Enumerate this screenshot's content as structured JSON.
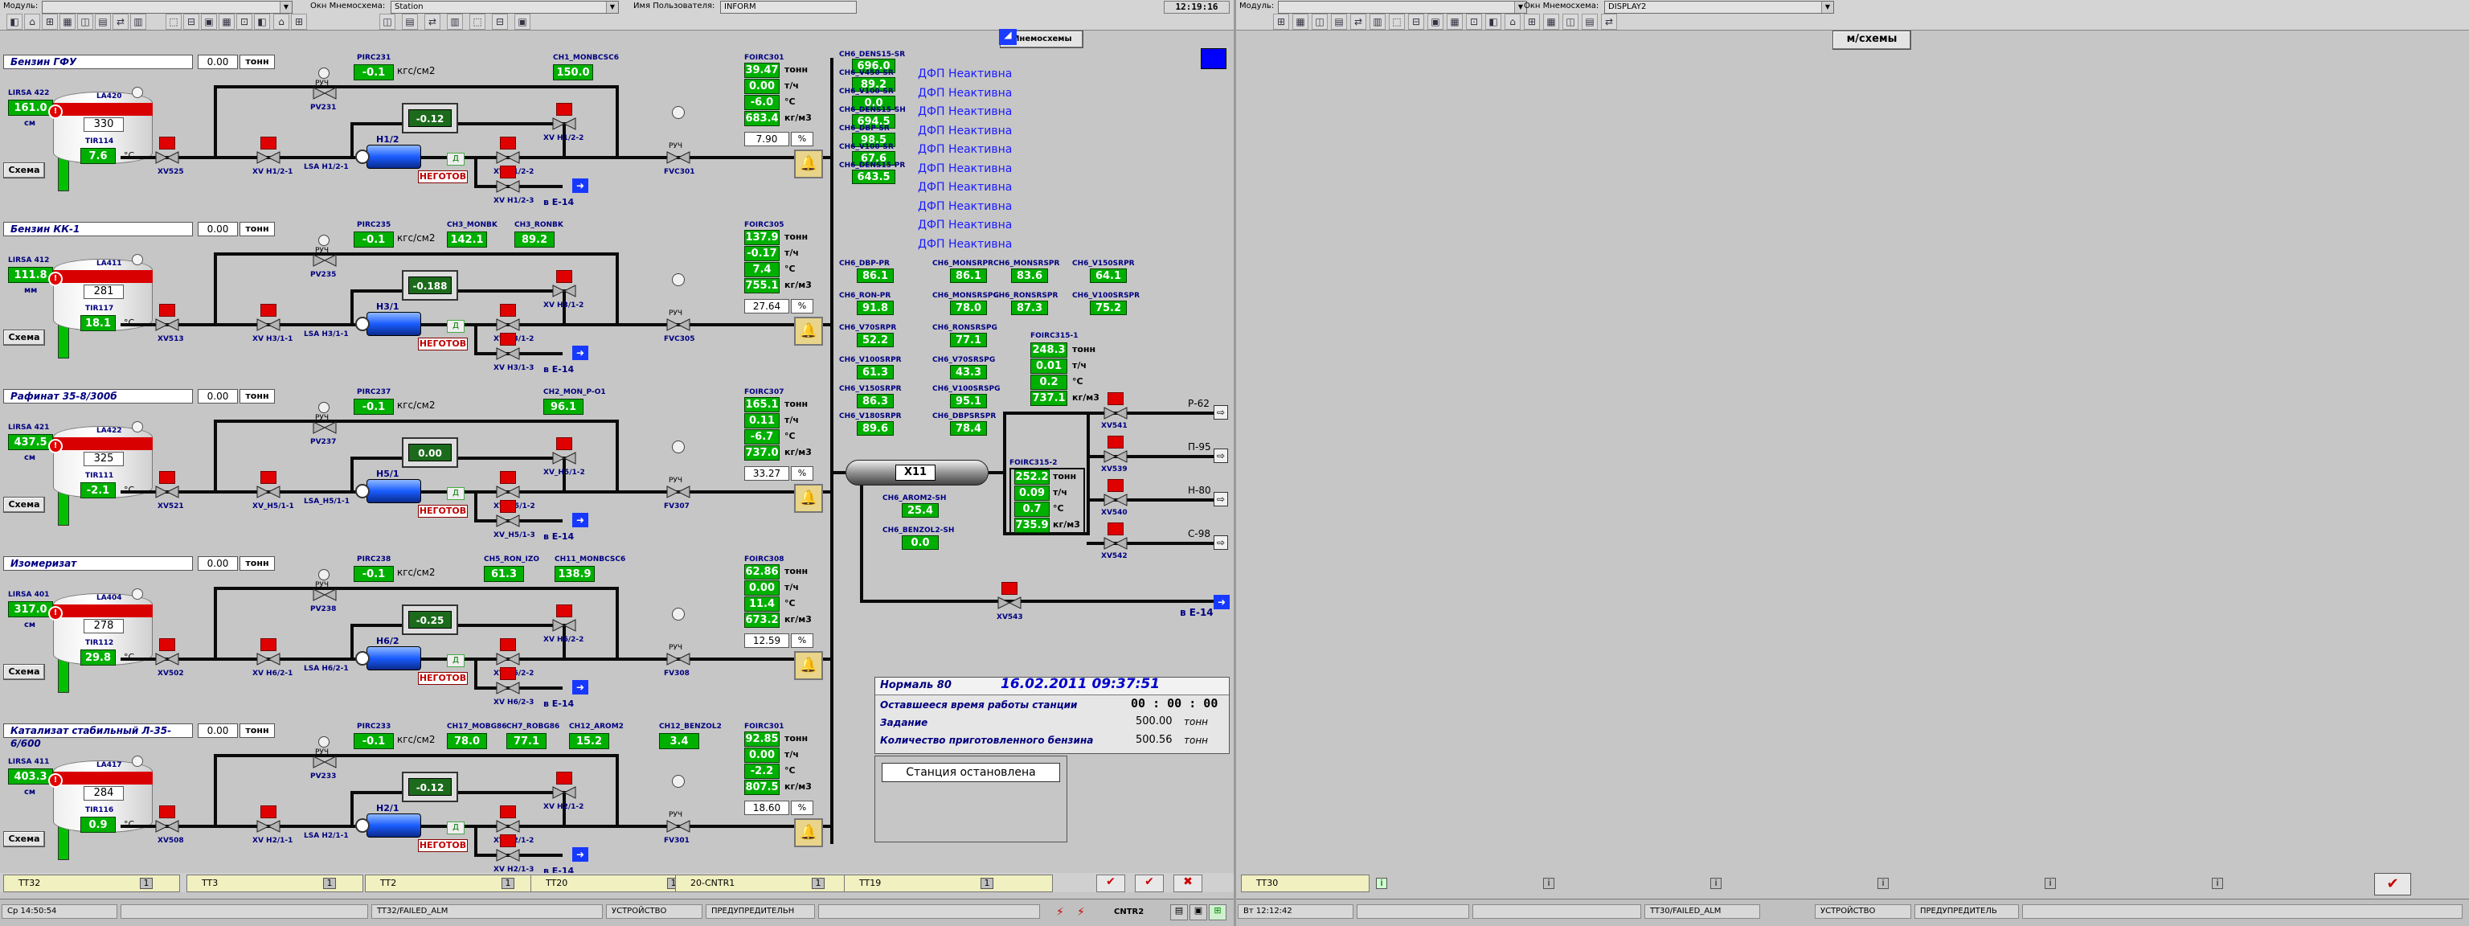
{
  "left_top": {
    "module_label": "Модуль:",
    "module_value": "",
    "mnemo_label": "Окн Мнемосхема:",
    "mnemo_value": "Station",
    "user_label": "Имя Пользователя:",
    "user_value": "INFORM",
    "time": "12:19:16",
    "mnemo_button": "Мнемосхемы"
  },
  "right_top": {
    "module_label": "Модуль:",
    "module_value": "",
    "mnemo_label": "Окн Мнемосхема:",
    "mnemo_value": "DISPLAY2",
    "scheme_button": "м/схемы"
  },
  "common": {
    "schema_btn": "Схема",
    "ton": "тонн",
    "tph": "т/ч",
    "degc": "°C",
    "kgm3": "кг/м3",
    "kgs": "кгс/см2",
    "pct": "%",
    "not_ready": "НЕГОТОВ",
    "d": "Д",
    "cm": "см",
    "mm": "мм",
    "ruch": "РУЧ",
    "to_e14": "в Е-14"
  },
  "lines": [
    {
      "title": "Бензин ГФУ",
      "title_val": "0.00",
      "lirsa": "LIRSA 422",
      "lirsa_val": "161.0",
      "lirsa_unit": "см",
      "level_pct": 0.7,
      "la": "LA420",
      "tank_val": "330",
      "tir": "TIR114",
      "tir_val": "7.6",
      "pirc": "PIRC231",
      "pirc_val": "-0.1",
      "pv": "PV231",
      "motor_val": "-0.12",
      "xv_left": "XV525",
      "xv_mid": "XV Н1/2-1",
      "lsa": "LSA Н1/2-1",
      "pump": "Н1/2",
      "xv_r1": "XV Н1/2-2",
      "xv_r2": "XV Н1/2-3",
      "fv": "FVC301",
      "tags": [
        {
          "label": "CH1_MONBCSC6",
          "val": "150.0"
        }
      ],
      "foirc": "FOIRC301",
      "f_ton": "39.47",
      "f_tph": "0.00",
      "f_t": "-6.0",
      "f_kg": "683.4",
      "pct_val": "7.90"
    },
    {
      "title": "Бензин КК-1",
      "title_val": "0.00",
      "lirsa": "LIRSA 412",
      "lirsa_val": "111.8",
      "lirsa_unit": "мм",
      "level_pct": 0.55,
      "la": "LA411",
      "tank_val": "281",
      "tir": "TIR117",
      "tir_val": "18.1",
      "pirc": "PIRC235",
      "pirc_val": "-0.1",
      "pv": "PV235",
      "motor_val": "-0.188",
      "xv_left": "XV513",
      "xv_mid": "XV Н3/1-1",
      "lsa": "LSA Н3/1-1",
      "pump": "Н3/1",
      "xv_r1": "XV Н3/1-2",
      "xv_r2": "XV Н3/1-3",
      "fv": "FVC305",
      "tags": [
        {
          "label": "CH3_MONBK",
          "val": "142.1"
        },
        {
          "label": "CH3_RONBK",
          "val": "89.2"
        }
      ],
      "foirc": "FOIRC305",
      "f_ton": "137.9",
      "f_tph": "-0.17",
      "f_t": "7.4",
      "f_kg": "755.1",
      "pct_val": "27.64"
    },
    {
      "title": "Рафинат 35-8/300б",
      "title_val": "0.00",
      "lirsa": "LIRSA 421",
      "lirsa_val": "437.5",
      "lirsa_unit": "см",
      "level_pct": 0.85,
      "la": "LA422",
      "tank_val": "325",
      "tir": "TIR111",
      "tir_val": "-2.1",
      "pirc": "PIRC237",
      "pirc_val": "-0.1",
      "pv": "PV237",
      "motor_val": "0.00",
      "xv_left": "XV521",
      "xv_mid": "XV_Н5/1-1",
      "lsa": "LSA_Н5/1-1",
      "pump": "Н5/1",
      "xv_r1": "XV_Н5/1-2",
      "xv_r2": "XV_Н5/1-3",
      "fv": "FV307",
      "tags": [
        {
          "label": "CH2_MON_P-O1",
          "val": "96.1"
        }
      ],
      "foirc": "FOIRC307",
      "f_ton": "165.1",
      "f_tph": "0.11",
      "f_t": "-6.7",
      "f_kg": "737.0",
      "pct_val": "33.27"
    },
    {
      "title": "Изомеризат",
      "title_val": "0.00",
      "lirsa": "LIRSA 401",
      "lirsa_val": "317.0",
      "lirsa_unit": "см",
      "level_pct": 0.75,
      "la": "LA404",
      "tank_val": "278",
      "tir": "TIR112",
      "tir_val": "29.8",
      "pirc": "PIRC238",
      "pirc_val": "-0.1",
      "pv": "PV238",
      "motor_val": "-0.25",
      "xv_left": "XV502",
      "xv_mid": "XV Н6/2-1",
      "lsa": "LSA Н6/2-1",
      "pump": "Н6/2",
      "xv_r1": "XV Н6/2-2",
      "xv_r2": "XV Н6/2-3",
      "fv": "FV308",
      "tags": [
        {
          "label": "CH5_RON_IZO",
          "val": "61.3"
        },
        {
          "label": "CH11_MONBCSC6",
          "val": "138.9"
        }
      ],
      "foirc": "FOIRC308",
      "f_ton": "62.86",
      "f_tph": "0.00",
      "f_t": "11.4",
      "f_kg": "673.2",
      "pct_val": "12.59"
    },
    {
      "title": "Катализат стабильный Л-35-6/600",
      "title_val": "0.00",
      "lirsa": "LIRSA 411",
      "lirsa_val": "403.3",
      "lirsa_unit": "см",
      "level_pct": 0.8,
      "la": "LA417",
      "tank_val": "284",
      "tir": "TIR116",
      "tir_val": "0.9",
      "pirc": "PIRC233",
      "pirc_val": "-0.1",
      "pv": "PV233",
      "motor_val": "-0.12",
      "xv_left": "XV508",
      "xv_mid": "XV Н2/1-1",
      "lsa": "LSA Н2/1-1",
      "pump": "Н2/1",
      "xv_r1": "XV Н2/1-2",
      "xv_r2": "XV Н2/1-3",
      "fv": "FV301",
      "tags": [
        {
          "label": "CH17_MOBG86",
          "val": "78.0"
        },
        {
          "label": "CH7_ROBG86",
          "val": "77.1"
        },
        {
          "label": "CH12_AROM2",
          "val": "15.2"
        },
        {
          "label": "CH12_BENZOL2",
          "val": "3.4"
        }
      ],
      "foirc": "FOIRC301",
      "f_ton": "92.85",
      "f_tph": "0.00",
      "f_t": "-2.2",
      "f_kg": "807.5",
      "pct_val": "18.60"
    }
  ],
  "analyzer": [
    {
      "label": "CH6_DENS15-SR",
      "val": "696.0"
    },
    {
      "label": "CH6_V450-SR",
      "val": "89.2"
    },
    {
      "label": "CH6_V100-SR",
      "val": "0.0"
    },
    {
      "label": "CH6_DENS15-SH",
      "val": "694.5"
    },
    {
      "label": "CH6_DBP-SR",
      "val": "98.5"
    },
    {
      "label": "CH6_V100-SR",
      "val": "67.6"
    },
    {
      "label": "CH6_DENS15-PR",
      "val": "643.5"
    }
  ],
  "dfp": [
    "ДФП Неактивна",
    "ДФП Неактивна",
    "ДФП Неактивна",
    "ДФП Неактивна",
    "ДФП Неактивна",
    "ДФП Неактивна",
    "ДФП Неактивна",
    "ДФП Неактивна",
    "ДФП Неактивна",
    "ДФП Неактивна"
  ],
  "grid": [
    {
      "label": "CH6_DBP-PR",
      "val": "86.1"
    },
    {
      "label": "CH6_MONSRPR",
      "val": "86.1"
    },
    {
      "label": "CH6_MONSRSPR",
      "val": "83.6"
    },
    {
      "label": "CH6_V150SRPR",
      "val": "64.1"
    },
    {
      "label": "CH6_RON-PR",
      "val": "91.8"
    },
    {
      "label": "CH6_MONSRSPG",
      "val": "78.0"
    },
    {
      "label": "CH6_RONSRSPR",
      "val": "87.3"
    },
    {
      "label": "CH6_V100SRSPR",
      "val": "75.2"
    },
    {
      "label": "CH6_V70SRPR",
      "val": "52.2"
    },
    {
      "label": "CH6_RONSRSPG",
      "val": "77.1"
    },
    {
      "label": "CH6_V100SRPR",
      "val": "61.3"
    },
    {
      "label": "CH6_V70SRSPG",
      "val": "43.3"
    },
    {
      "label": "CH6_V150SRPR",
      "val": "86.3"
    },
    {
      "label": "CH6_V100SRSPG",
      "val": "95.1"
    },
    {
      "label": "CH6_V180SRPR",
      "val": "89.6"
    },
    {
      "label": "CH6_DBPSRSPR",
      "val": "78.4"
    }
  ],
  "foirc1": {
    "label": "FOIRC315-1",
    "ton": "248.3",
    "tph": "0.01",
    "t": "0.2",
    "kg": "737.1"
  },
  "foirc2": {
    "label": "FOIRC315-2",
    "ton": "252.2",
    "tph": "0.09",
    "t": "0.7",
    "kg": "735.9"
  },
  "mixer": {
    "label": "X11"
  },
  "arom": [
    {
      "label": "CH6_AROM2-SH",
      "val": "25.4"
    },
    {
      "label": "CH6_BENZOL2-SH",
      "val": "0.0"
    }
  ],
  "outputs": [
    {
      "valve": "XV541",
      "dest": "Р-62"
    },
    {
      "valve": "XV539",
      "dest": "П-95"
    },
    {
      "valve": "XV540",
      "dest": "Н-80"
    },
    {
      "valve": "XV542",
      "dest": "С-98"
    }
  ],
  "xv543": {
    "valve": "XV543",
    "dest": "в Е-14"
  },
  "status_panel": {
    "grade": "Нормаль 80",
    "datetime": "16.02.2011 09:37:51",
    "remaining_label": "Оставшееся время работы станции",
    "remaining_val": "00 : 00 : 00",
    "task_label": "Задание",
    "task_val": "500.00",
    "task_unit": "тонн",
    "qty_label": "Количество приготовленного бензина",
    "qty_val": "500.56",
    "qty_unit": "тонн",
    "state": "Станция остановлена"
  },
  "alarms_left": [
    "TT32",
    "TT3",
    "TT2",
    "TT20",
    "20-CNTR1",
    "TT19"
  ],
  "alarms_right": [
    "TT30"
  ],
  "statusbar_left": {
    "date": "Ср 14:50:54",
    "alm": "TT32/FAILED_ALM",
    "dev": "УСТРОЙСТВО",
    "warn": "ПРЕДУПРЕДИТЕЛЬН",
    "cntr": "CNTR2"
  },
  "statusbar_right": {
    "date": "Вт 12:12:42",
    "alm": "TT30/FAILED_ALM",
    "dev": "УСТРОЙСТВО",
    "warn": "ПРЕДУПРЕДИТЕЛЬ"
  },
  "colors": {
    "accent_green": "#00b000",
    "alarm_red": "#e00000",
    "hmi_bg": "#c6c6c6",
    "link_blue": "#1a1aff"
  }
}
